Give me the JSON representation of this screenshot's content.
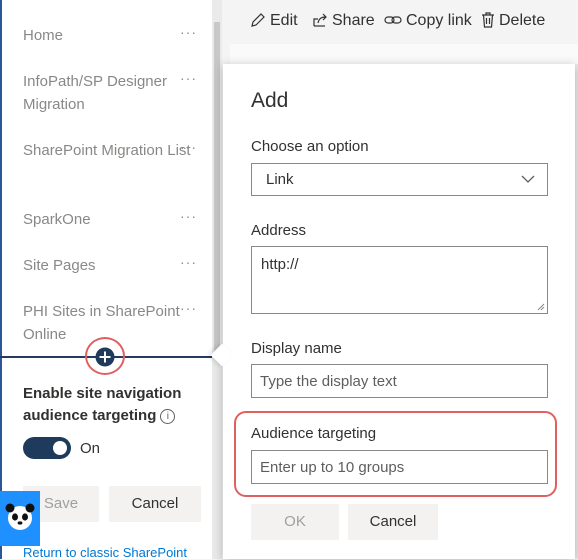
{
  "nav": {
    "items": [
      {
        "label": "Home"
      },
      {
        "label": "InfoPath/SP Designer Migration"
      },
      {
        "label": "SharePoint Migration List"
      },
      {
        "label": "SparkOne"
      },
      {
        "label": "Site Pages"
      },
      {
        "label": "PHI Sites in SharePoint Online"
      }
    ],
    "more_glyph": "···",
    "add_glyph": "+"
  },
  "audience_toggle": {
    "label": "Enable site navigation audience targeting",
    "info_glyph": "i",
    "state_label": "On",
    "on": true
  },
  "left_buttons": {
    "save": "Save",
    "cancel": "Cancel"
  },
  "return_link": "Return to classic SharePoint",
  "command_bar": {
    "edit": "Edit",
    "share": "Share",
    "copy_link": "Copy link",
    "delete": "Delete"
  },
  "add_panel": {
    "title": "Add",
    "option_label": "Choose an option",
    "option_value": "Link",
    "address_label": "Address",
    "address_value": "http://",
    "display_name_label": "Display name",
    "display_name_placeholder": "Type the display text",
    "audience_label": "Audience targeting",
    "audience_placeholder": "Enter up to 10 groups",
    "ok": "OK",
    "cancel": "Cancel"
  },
  "colors": {
    "accent_dark": "#1e3b5c",
    "highlight_red": "#e06060",
    "link_blue": "#0078d4"
  }
}
